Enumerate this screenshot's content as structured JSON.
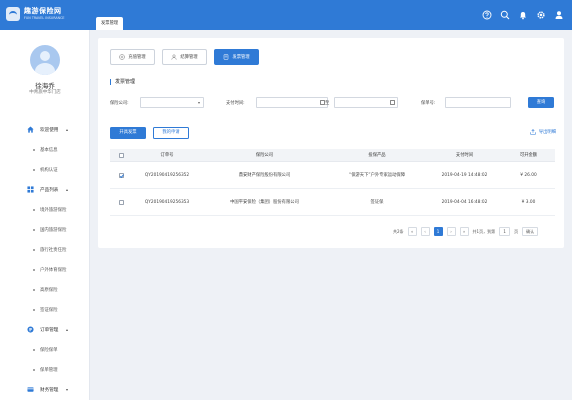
{
  "brand": {
    "title": "趣游保险网",
    "subtitle": "FUN TRAVEL INSURANCE"
  },
  "header_icons": [
    "help-icon",
    "search-icon",
    "bell-icon",
    "gear-icon",
    "user-icon"
  ],
  "user": {
    "name": "徐海乔",
    "org": "中青旅中华门店"
  },
  "sidebar": {
    "groups": [
      {
        "icon": "home-icon",
        "label": "欢迎使用",
        "items": [
          "基本信息",
          "机构认证"
        ]
      },
      {
        "icon": "grid-icon",
        "label": "产品列表",
        "items": [
          "境外旅游保险",
          "国内旅游保险",
          "旅行社责任险",
          "户外体育保险",
          "高原保险",
          "签证保险"
        ]
      },
      {
        "icon": "order-icon",
        "label": "订单管理",
        "items": [
          "保险保单",
          "保单管理"
        ]
      },
      {
        "icon": "finance-icon",
        "label": "财务管理",
        "items": []
      }
    ]
  },
  "breadcrumb": {
    "tab": "发票管理"
  },
  "category_tabs": [
    {
      "icon": "plus-circle-icon",
      "label": "充值管理",
      "active": false
    },
    {
      "icon": "user-outline-icon",
      "label": "结算管理",
      "active": false
    },
    {
      "icon": "doc-icon",
      "label": "发票管理",
      "active": true
    }
  ],
  "section_title": "发票管理",
  "filters": {
    "company_label": "保险公司:",
    "company_value": "",
    "paytime_label": "支付时间:",
    "to_label": "至",
    "policy_label": "保单号:",
    "query_button": "查询"
  },
  "actions": {
    "open_invoice": "开具发票",
    "my_requests": "我的申请",
    "export": "导出明细"
  },
  "table": {
    "columns": [
      "订单号",
      "保险公司",
      "投保产品",
      "支付时间",
      "可开金额"
    ],
    "rows": [
      {
        "checked": true,
        "order_no": "QY20190419256352",
        "company": "鼎安财产保险股份有限公司",
        "product": "“保游天下”户外专家运动保障",
        "pay_time": "2019-04-19  14:48:02",
        "amount": "¥ 26.00"
      },
      {
        "checked": false,
        "order_no": "QY20190419256353",
        "company": "中国平安保险（集团）股份有限公司",
        "product": "签证保",
        "pay_time": "2019-04-04  16:48:02",
        "amount": "¥ 3.00"
      }
    ]
  },
  "pagination": {
    "total": "共2条",
    "first": "«",
    "prev": "‹",
    "current": "1",
    "next": "›",
    "last": "»",
    "pages_info": "共1页，到第",
    "page_input": "1",
    "page_suffix": "页",
    "go": "确认"
  },
  "colors": {
    "primary": "#2f7ad6",
    "background": "#eef1f6"
  }
}
